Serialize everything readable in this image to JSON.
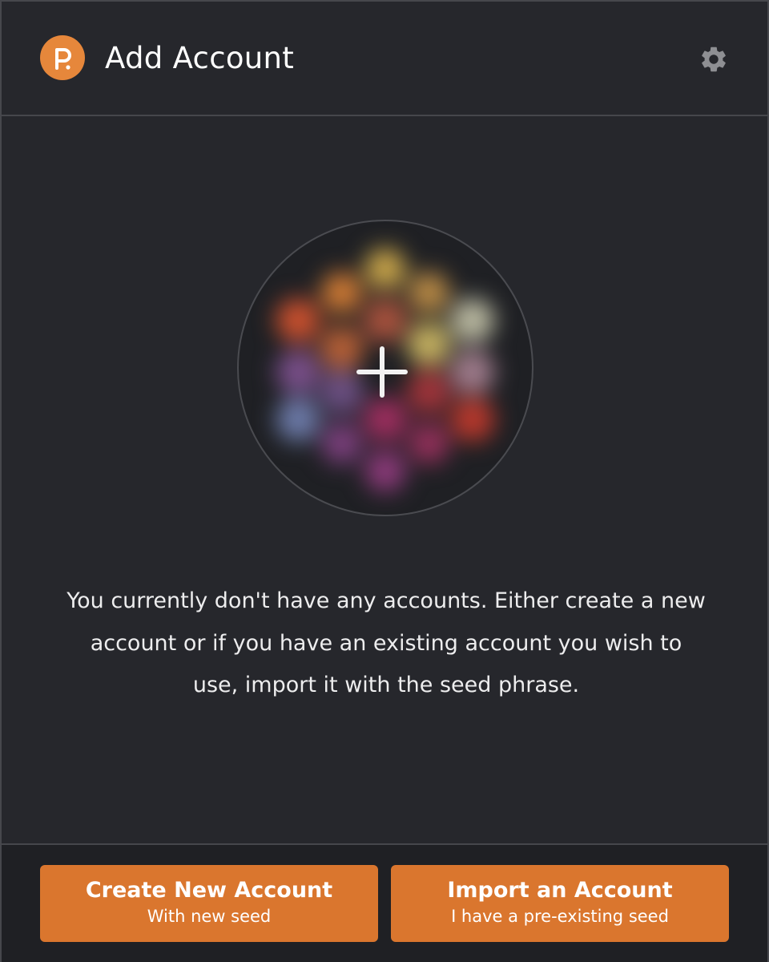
{
  "header": {
    "title": "Add Account",
    "logo_icon": "polkadot-logo",
    "settings_icon": "gear-icon"
  },
  "add_account_circle": {
    "icon": "plus-icon"
  },
  "message": "You currently don't have any accounts. Either create a new account or if you have an existing account you wish to use, import it with the seed phrase.",
  "footer": {
    "create_button": {
      "title": "Create New Account",
      "subtitle": "With new seed"
    },
    "import_button": {
      "title": "Import an Account",
      "subtitle": "I have a pre-existing seed"
    }
  },
  "colors": {
    "background": "#26272c",
    "accent": "#da762e",
    "divider": "#46474c",
    "text": "#ededee"
  }
}
